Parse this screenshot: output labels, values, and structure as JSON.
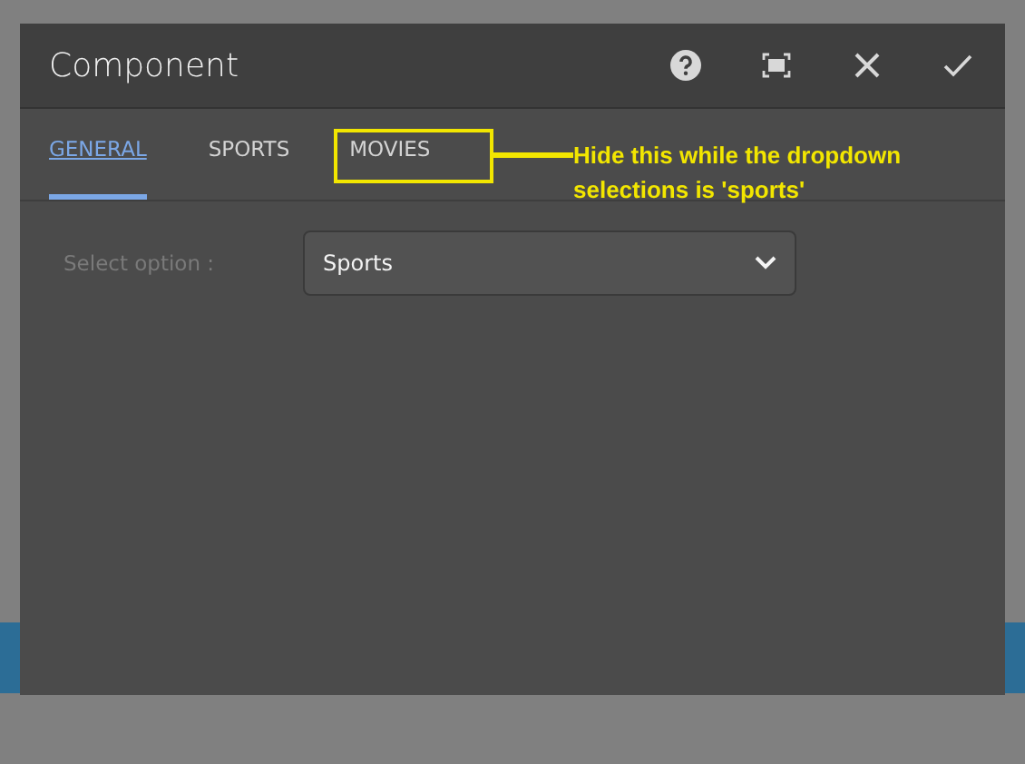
{
  "dialog": {
    "title": "Component"
  },
  "tabs": [
    {
      "label": "GENERAL",
      "selected": true
    },
    {
      "label": "SPORTS",
      "selected": false
    },
    {
      "label": "MOVIES",
      "selected": false,
      "highlighted": true
    }
  ],
  "annotation": {
    "text": "Hide this while the dropdown selections is 'sports'"
  },
  "form": {
    "label": "Select option :",
    "value": "Sports"
  }
}
